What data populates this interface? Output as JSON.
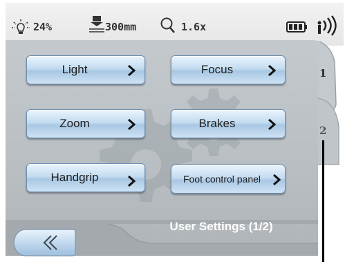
{
  "status_bar": {
    "light_level": "24%",
    "working_distance": "300mm",
    "zoom_factor": "1.6x",
    "icons": [
      "brightness-icon",
      "working-distance-icon",
      "magnifier-icon",
      "battery-icon",
      "wireless-signal-icon"
    ]
  },
  "menu": {
    "buttons": [
      {
        "label": "Light",
        "icon": "chevron-right-icon"
      },
      {
        "label": "Focus",
        "icon": "chevron-right-icon"
      },
      {
        "label": "Zoom",
        "icon": "chevron-right-icon"
      },
      {
        "label": "Brakes",
        "icon": "chevron-right-icon"
      },
      {
        "label": "Handgrip",
        "icon": "chevron-right-icon"
      },
      {
        "label": "Foot control panel",
        "icon": "chevron-right-icon"
      }
    ]
  },
  "tabs": [
    {
      "label": "1",
      "active": true
    },
    {
      "label": "2",
      "active": false
    }
  ],
  "footer": {
    "back_icon": "double-chevron-left-icon",
    "title": "User Settings (1/2)"
  },
  "colors": {
    "button_fill": "#c4dcf0",
    "button_border": "#6f8fb0",
    "panel": "#b9bfc3",
    "footer": "#a3a9ad",
    "title_text": "#ffffff"
  }
}
